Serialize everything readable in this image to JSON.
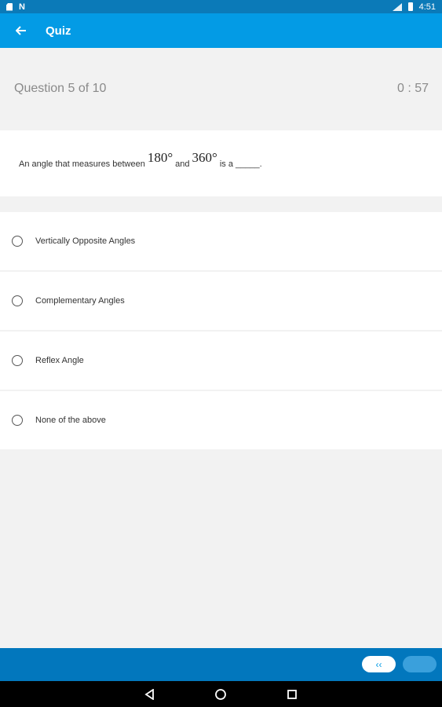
{
  "status_bar": {
    "time": "4:51",
    "icons": [
      "sd-card-icon",
      "n-notification-icon",
      "signal-icon",
      "battery-icon"
    ]
  },
  "app_bar": {
    "title": "Quiz",
    "back_icon": "arrow-left-icon"
  },
  "quiz": {
    "progress": "Question 5 of  10",
    "timer": "0 : 57",
    "question": {
      "part1": "An angle that measures between",
      "math1": "180°",
      "part2": "and",
      "math2": "360°",
      "part3": "is a _____."
    },
    "options": [
      {
        "label": "Vertically Opposite Angles"
      },
      {
        "label": "Complementary Angles"
      },
      {
        "label": "Reflex Angle"
      },
      {
        "label": "None of the above"
      }
    ]
  },
  "bottom_bar": {
    "prev_label": "‹‹",
    "colors": {
      "bar": "#0277bd",
      "accent": "#039be5"
    }
  },
  "nav_bar": {
    "icons": [
      "back-triangle-icon",
      "home-circle-icon",
      "recents-square-icon"
    ]
  }
}
